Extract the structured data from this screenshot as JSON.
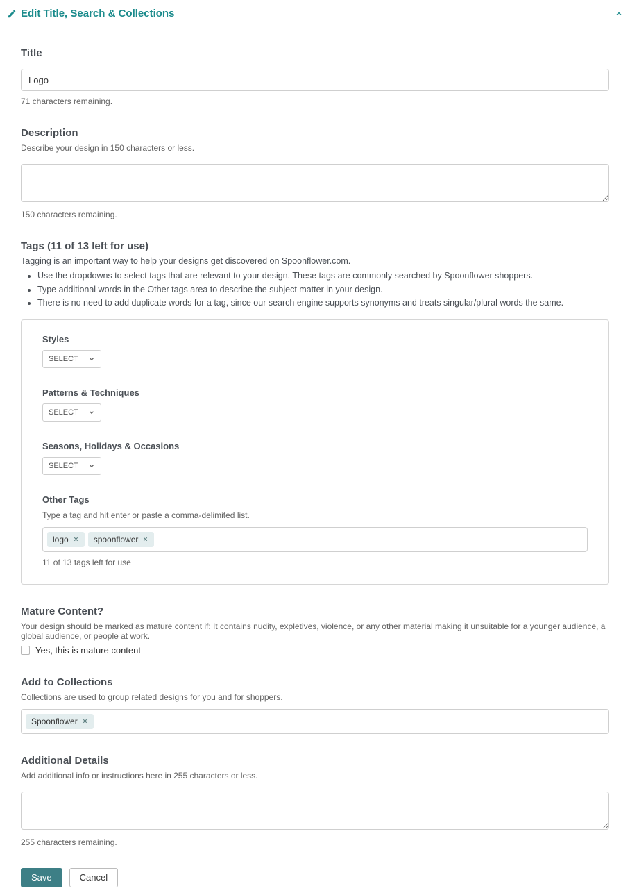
{
  "header": {
    "title": "Edit Title, Search & Collections"
  },
  "title_section": {
    "heading": "Title",
    "value": "Logo",
    "remaining": "71 characters remaining."
  },
  "description_section": {
    "heading": "Description",
    "subtext": "Describe your design in 150 characters or less.",
    "value": "",
    "remaining": "150 characters remaining."
  },
  "tags_section": {
    "heading": "Tags (11 of 13 left for use)",
    "intro": "Tagging is an important way to help your designs get discovered on Spoonflower.com.",
    "bullets": [
      "Use the dropdowns to select tags that are relevant to your design. These tags are commonly searched by Spoonflower shoppers.",
      "Type additional words in the Other tags area to describe the subject matter in your design.",
      "There is no need to add duplicate words for a tag, since our search engine supports synonyms and treats singular/plural words the same."
    ],
    "groups": {
      "styles": {
        "label": "Styles",
        "select": "SELECT"
      },
      "patterns": {
        "label": "Patterns & Techniques",
        "select": "SELECT"
      },
      "seasons": {
        "label": "Seasons, Holidays & Occasions",
        "select": "SELECT"
      },
      "other": {
        "label": "Other Tags",
        "subtext": "Type a tag and hit enter or paste a comma-delimited list.",
        "chips": [
          "logo",
          "spoonflower"
        ],
        "helper": "11 of 13 tags left for use"
      }
    }
  },
  "mature_section": {
    "heading": "Mature Content?",
    "subtext": "Your design should be marked as mature content if: It contains nudity, expletives, violence, or any other material making it unsuitable for a younger audience, a global audience, or people at work.",
    "checkbox_label": "Yes, this is mature content"
  },
  "collections_section": {
    "heading": "Add to Collections",
    "subtext": "Collections are used to group related designs for you and for shoppers.",
    "chips": [
      "Spoonflower"
    ]
  },
  "details_section": {
    "heading": "Additional Details",
    "subtext": "Add additional info or instructions here in 255 characters or less.",
    "value": "",
    "remaining": "255 characters remaining."
  },
  "buttons": {
    "save": "Save",
    "cancel": "Cancel"
  }
}
